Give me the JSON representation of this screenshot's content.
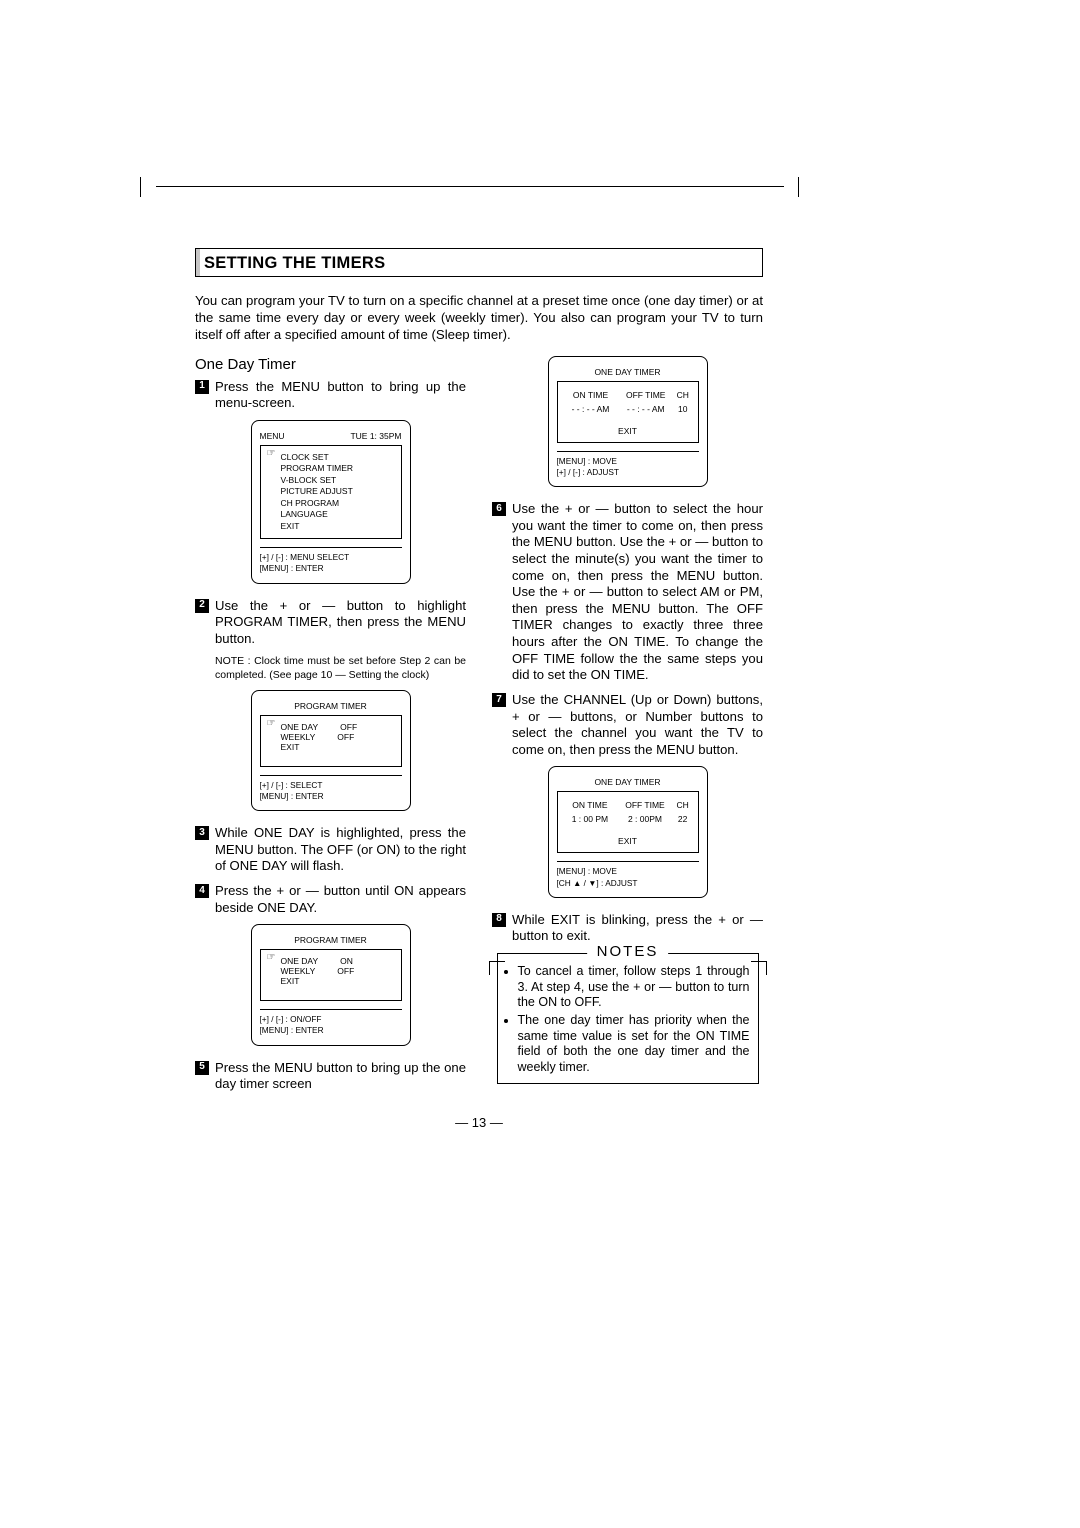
{
  "section_title": "SETTING THE TIMERS",
  "intro": "You can program your TV to turn on a specific channel at a preset time once (one day timer) or at the same time every day or every week (weekly timer). You also can program your TV to turn itself off after a specified amount of time (Sleep timer).",
  "subhead": "One Day Timer",
  "steps": {
    "s1": "Press the MENU button to bring up the menu-screen.",
    "s2": "Use the + or — button to highlight PROGRAM TIMER, then press the MENU button.",
    "s2_note": "NOTE : Clock time must be set before Step 2 can be completed. (See page 10 — Setting the clock)",
    "s3": "While ONE DAY is highlighted, press the MENU button. The OFF (or ON) to the right of ONE DAY will flash.",
    "s4": "Press the + or — button until ON appears beside ONE DAY.",
    "s5": "Press the MENU button to bring up the one day timer screen",
    "s6": "Use the + or — button to select the hour you want the timer to come on, then press the MENU button. Use the + or — button to select the minute(s) you want the timer to come on, then press the MENU button. Use the + or — button to select AM or PM, then press the MENU button. The OFF TIMER changes to exactly three three hours after the ON TIME. To change the OFF TIME follow the the same steps you did to set the ON TIME.",
    "s7": "Use the CHANNEL (Up or Down) buttons, + or — buttons, or Number buttons to select the channel you want the TV to come on, then press the MENU button.",
    "s8": "While EXIT is blinking, press the + or — button to exit."
  },
  "osd_menu": {
    "header_left": "MENU",
    "header_right": "TUE 1: 35PM",
    "items": [
      "CLOCK SET",
      "PROGRAM TIMER",
      "V-BLOCK SET",
      "PICTURE ADJUST",
      "CH PROGRAM",
      "LANGUAGE",
      "EXIT"
    ],
    "foot1": "[+] / [-] : MENU SELECT",
    "foot2": "[MENU] : ENTER"
  },
  "osd_pt1": {
    "title": "PROGRAM TIMER",
    "r1a": "ONE DAY",
    "r1b": "OFF",
    "r2a": "WEEKLY",
    "r2b": "OFF",
    "r3": "EXIT",
    "foot1": "[+] / [-]  :  SELECT",
    "foot2": "[MENU] :  ENTER"
  },
  "osd_pt2": {
    "title": "PROGRAM TIMER",
    "r1a": "ONE DAY",
    "r1b": "ON",
    "r2a": "WEEKLY",
    "r2b": "OFF",
    "r3": "EXIT",
    "foot1": "[+] / [-]  :  ON/OFF",
    "foot2": "[MENU] :  ENTER"
  },
  "osd_odt1": {
    "title": "ONE DAY TIMER",
    "h1": "ON TIME",
    "h2": "OFF TIME",
    "h3": "CH",
    "v1": "- - : - - AM",
    "v2": "- - : - - AM",
    "v3": "10",
    "exit": "EXIT",
    "foot1": "[MENU] : MOVE",
    "foot2": "[+] / [-]    : ADJUST"
  },
  "osd_odt2": {
    "title": "ONE DAY TIMER",
    "h1": "ON TIME",
    "h2": "OFF TIME",
    "h3": "CH",
    "v1": "1 : 00 PM",
    "v2": "2 : 00PM",
    "v3": "22",
    "exit": "EXIT",
    "foot1": "[MENU]       : MOVE",
    "foot2": "[CH ▲ / ▼]  : ADJUST"
  },
  "notes": {
    "title": "NOTES",
    "n1": "To cancel a timer, follow steps 1 through 3. At step 4, use the + or — button to turn the ON to OFF.",
    "n2": "The one day timer has priority when the same time value is set for the ON TIME field of both the one day timer and the weekly timer."
  },
  "page_number": "— 13 —"
}
